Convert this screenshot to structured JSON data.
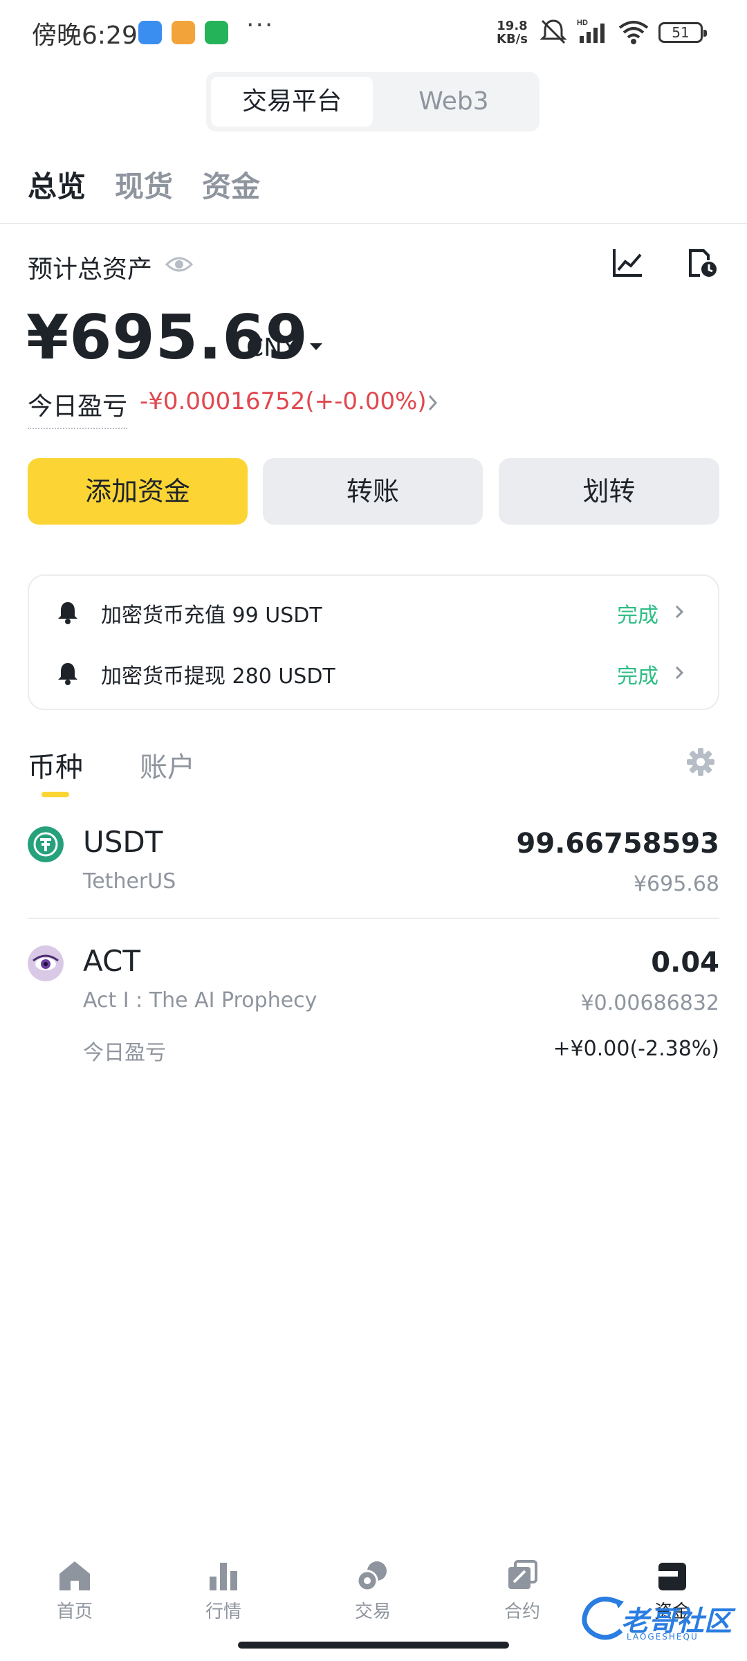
{
  "status_bar": {
    "time": "傍晚6:29",
    "dots": "···",
    "net_speed_value": "19.8",
    "net_speed_unit": "KB/s",
    "battery": "51"
  },
  "switcher": {
    "items": [
      "交易平台",
      "Web3"
    ],
    "active": "交易平台"
  },
  "top_tabs": [
    "总览",
    "现货",
    "资金"
  ],
  "balance": {
    "label": "预计总资产",
    "amount": "¥695.69",
    "currency": "CNY",
    "pnl_label": "今日盈亏",
    "pnl_value": "-¥0.00016752(+-0.00%)"
  },
  "actions": {
    "add_funds": "添加资金",
    "transfer": "转账",
    "internal_transfer": "划转"
  },
  "notices": [
    {
      "text": "加密货币充值 99 USDT",
      "status": "完成"
    },
    {
      "text": "加密货币提现 280 USDT",
      "status": "完成"
    }
  ],
  "coin_tabs": [
    "币种",
    "账户"
  ],
  "assets": [
    {
      "symbol": "USDT",
      "name": "TetherUS",
      "amount": "99.66758593",
      "value": "¥695.68"
    },
    {
      "symbol": "ACT",
      "name": "Act I : The AI Prophecy",
      "amount": "0.04",
      "value": "¥0.00686832",
      "pnl_label": "今日盈亏",
      "pnl_value": "+¥0.00(-2.38%)"
    }
  ],
  "bottom_nav": [
    "首页",
    "行情",
    "交易",
    "合约",
    "资金"
  ],
  "watermark": {
    "text": "老哥社区",
    "sub": "LAOGESHEQU"
  },
  "colors": {
    "accent": "#fcd535",
    "negative": "#e0474e",
    "positive": "#2ebd85",
    "usdt": "#26a17b"
  }
}
